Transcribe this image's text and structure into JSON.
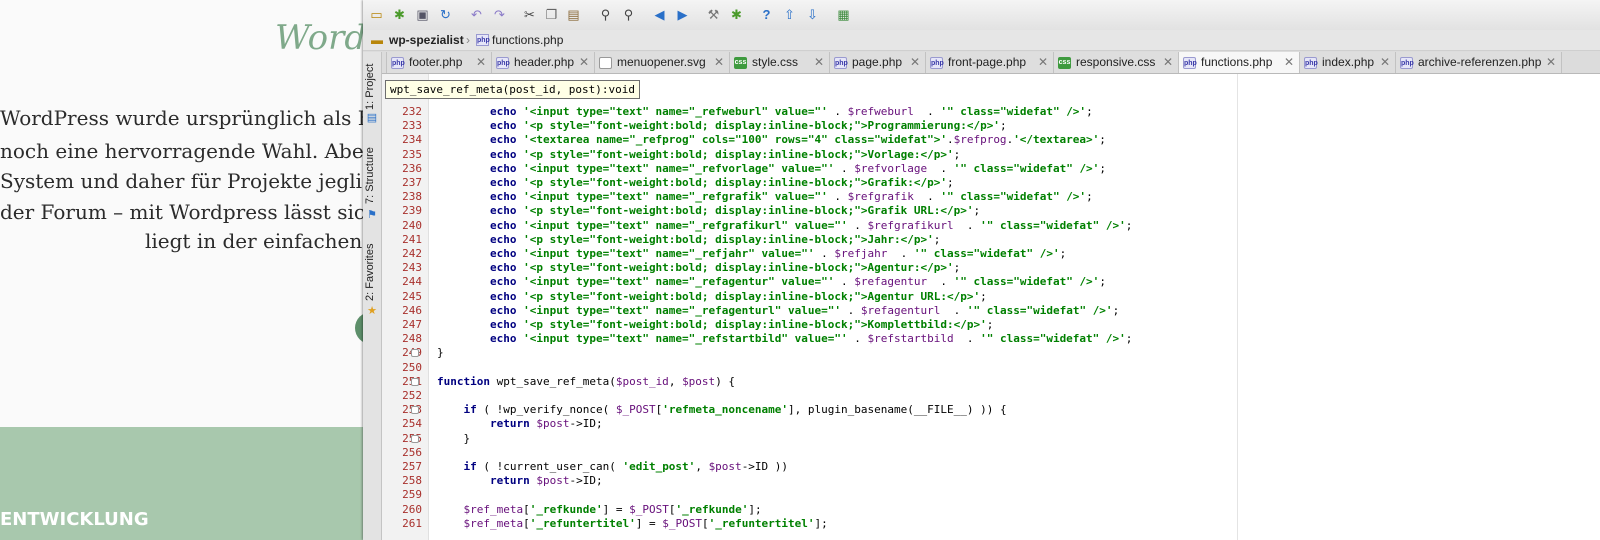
{
  "website": {
    "title": "Word",
    "paragraph_lines": [
      "WordPress wurde ursprünglich als Blog-",
      "noch eine hervorragende Wahl. Aber es c",
      "System und daher für Projekte jeglicher I",
      "der Forum – mit Wordpress lässt sich so",
      "liegt in der einfachen un"
    ],
    "footer_heading": "ENTWICKLUNG"
  },
  "ide": {
    "toolbar_icons": [
      "folder-icon",
      "bug-icon",
      "save-icon",
      "sync-icon",
      "undo-icon",
      "redo-icon",
      "cut-icon",
      "copy-icon",
      "paste-icon",
      "find-icon",
      "replace-icon",
      "back-icon",
      "forward-icon",
      "wrench-icon",
      "debug-icon",
      "help-icon",
      "upload-icon",
      "deploy-icon",
      "plugin-icon"
    ],
    "breadcrumb": {
      "project": "wp-spezialist",
      "file": "functions.php"
    },
    "tabs": [
      {
        "label": "footer.php",
        "type": "php",
        "active": false
      },
      {
        "label": "header.php",
        "type": "php",
        "active": false
      },
      {
        "label": "menuopener.svg",
        "type": "svg",
        "active": false
      },
      {
        "label": "style.css",
        "type": "css",
        "active": false
      },
      {
        "label": "page.php",
        "type": "php",
        "active": false
      },
      {
        "label": "front-page.php",
        "type": "php",
        "active": false
      },
      {
        "label": "responsive.css",
        "type": "css",
        "active": false
      },
      {
        "label": "functions.php",
        "type": "php",
        "active": true
      },
      {
        "label": "index.php",
        "type": "php",
        "active": false
      },
      {
        "label": "archive-referenzen.php",
        "type": "php",
        "active": false
      }
    ],
    "side_tabs": [
      "1: Project",
      "7: Structure",
      "2: Favorites"
    ],
    "tooltip": "wpt_save_ref_meta(post_id, post):void",
    "code_lines": [
      {
        "n": "232",
        "text": "        echo '<input type=\"text\" name=\"_refweburl\" value=\"' . $refweburl  . '\" class=\"widefat\" />';"
      },
      {
        "n": "233",
        "text": "        echo '<p style=\"font-weight:bold; display:inline-block;\">Programmierung:</p>';"
      },
      {
        "n": "234",
        "text": "        echo '<textarea name=\"_refprog\" cols=\"100\" rows=\"4\" class=\"widefat\">'.$refprog.'</textarea>';"
      },
      {
        "n": "235",
        "text": "        echo '<p style=\"font-weight:bold; display:inline-block;\">Vorlage:</p>';"
      },
      {
        "n": "236",
        "text": "        echo '<input type=\"text\" name=\"_refvorlage\" value=\"' . $refvorlage  . '\" class=\"widefat\" />';"
      },
      {
        "n": "237",
        "text": "        echo '<p style=\"font-weight:bold; display:inline-block;\">Grafik:</p>';"
      },
      {
        "n": "238",
        "text": "        echo '<input type=\"text\" name=\"_refgrafik\" value=\"' . $refgrafik  . '\" class=\"widefat\" />';"
      },
      {
        "n": "239",
        "text": "        echo '<p style=\"font-weight:bold; display:inline-block;\">Grafik URL:</p>';"
      },
      {
        "n": "240",
        "text": "        echo '<input type=\"text\" name=\"_refgrafikurl\" value=\"' . $refgrafikurl  . '\" class=\"widefat\" />';"
      },
      {
        "n": "241",
        "text": "        echo '<p style=\"font-weight:bold; display:inline-block;\">Jahr:</p>';"
      },
      {
        "n": "242",
        "text": "        echo '<input type=\"text\" name=\"_refjahr\" value=\"' . $refjahr  . '\" class=\"widefat\" />';"
      },
      {
        "n": "243",
        "text": "        echo '<p style=\"font-weight:bold; display:inline-block;\">Agentur:</p>';"
      },
      {
        "n": "244",
        "text": "        echo '<input type=\"text\" name=\"_refagentur\" value=\"' . $refagentur  . '\" class=\"widefat\" />';"
      },
      {
        "n": "245",
        "text": "        echo '<p style=\"font-weight:bold; display:inline-block;\">Agentur URL:</p>';"
      },
      {
        "n": "246",
        "text": "        echo '<input type=\"text\" name=\"_refagenturl\" value=\"' . $refagenturl  . '\" class=\"widefat\" />';"
      },
      {
        "n": "247",
        "text": "        echo '<p style=\"font-weight:bold; display:inline-block;\">Komplettbild:</p>';"
      },
      {
        "n": "248",
        "text": "        echo '<input type=\"text\" name=\"_refstartbild\" value=\"' . $refstartbild  . '\" class=\"widefat\" />';"
      },
      {
        "n": "249",
        "text": "}"
      },
      {
        "n": "250",
        "text": ""
      },
      {
        "n": "251",
        "text": "function wpt_save_ref_meta($post_id, $post) {"
      },
      {
        "n": "252",
        "text": ""
      },
      {
        "n": "253",
        "text": "    if ( !wp_verify_nonce( $_POST['refmeta_noncename'], plugin_basename(__FILE__) )) {"
      },
      {
        "n": "254",
        "text": "        return $post->ID;"
      },
      {
        "n": "255",
        "text": "    }"
      },
      {
        "n": "256",
        "text": ""
      },
      {
        "n": "257",
        "text": "    if ( !current_user_can( 'edit_post', $post->ID ))"
      },
      {
        "n": "258",
        "text": "        return $post->ID;"
      },
      {
        "n": "259",
        "text": ""
      },
      {
        "n": "260",
        "text": "    $ref_meta['_refkunde'] = $_POST['_refkunde'];"
      },
      {
        "n": "261",
        "text": "    $ref_meta['_refuntertitel'] = $_POST['_refuntertitel'];"
      }
    ],
    "colors": {
      "keyword": "#000080",
      "string": "#008000",
      "variable": "#660e7a",
      "line_number": "#a8302c",
      "current_line": "#fffbd9",
      "site_title": "#7fa98a",
      "footer_band": "#a8c8ad"
    }
  }
}
